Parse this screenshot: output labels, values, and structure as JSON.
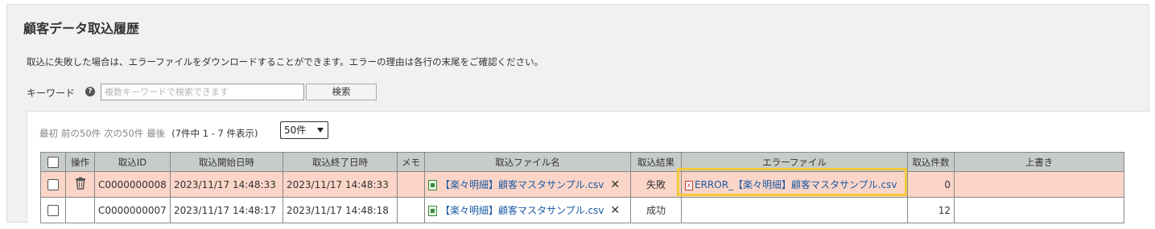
{
  "page": {
    "title": "顧客データ取込履歴",
    "description": "取込に失敗した場合は、エラーファイルをダウンロードすることができます。エラーの理由は各行の末尾をご確認ください。"
  },
  "search": {
    "label": "キーワード",
    "help_icon": "?",
    "placeholder": "複数キーワードで検索できます",
    "value": "",
    "button": "検索"
  },
  "pager": {
    "first": "最初",
    "prev": "前の50件",
    "next": "次の50件",
    "last": "最後",
    "count": "(7件中 1 - 7 件表示)",
    "page_size": "50件"
  },
  "table": {
    "columns": [
      "",
      "操作",
      "取込ID",
      "取込開始日時",
      "取込終了日時",
      "メモ",
      "取込ファイル名",
      "取込結果",
      "エラーファイル",
      "取込件数",
      "上書き"
    ],
    "rows": [
      {
        "id": "C0000000008",
        "start": "2023/11/17 14:48:33",
        "end": "2023/11/17 14:48:33",
        "memo": "",
        "file": "【楽々明細】顧客マスタサンプル.csv",
        "result": "失敗",
        "error_file": "ERROR_【楽々明細】顧客マスタサンプル.csv",
        "count": "0",
        "overwrite": ""
      },
      {
        "id": "C0000000007",
        "start": "2023/11/17 14:48:17",
        "end": "2023/11/17 14:48:18",
        "memo": "",
        "file": "【楽々明細】顧客マスタサンプル.csv",
        "result": "成功",
        "error_file": "",
        "count": "12",
        "overwrite": ""
      }
    ],
    "delete_icon": "trash-icon",
    "remove_glyph": "✕"
  },
  "colors": {
    "failed_row": "#fbd5c7",
    "header_bg": "#c8ccc8",
    "link": "#1a5aa5",
    "highlight": "#f3c93a"
  }
}
